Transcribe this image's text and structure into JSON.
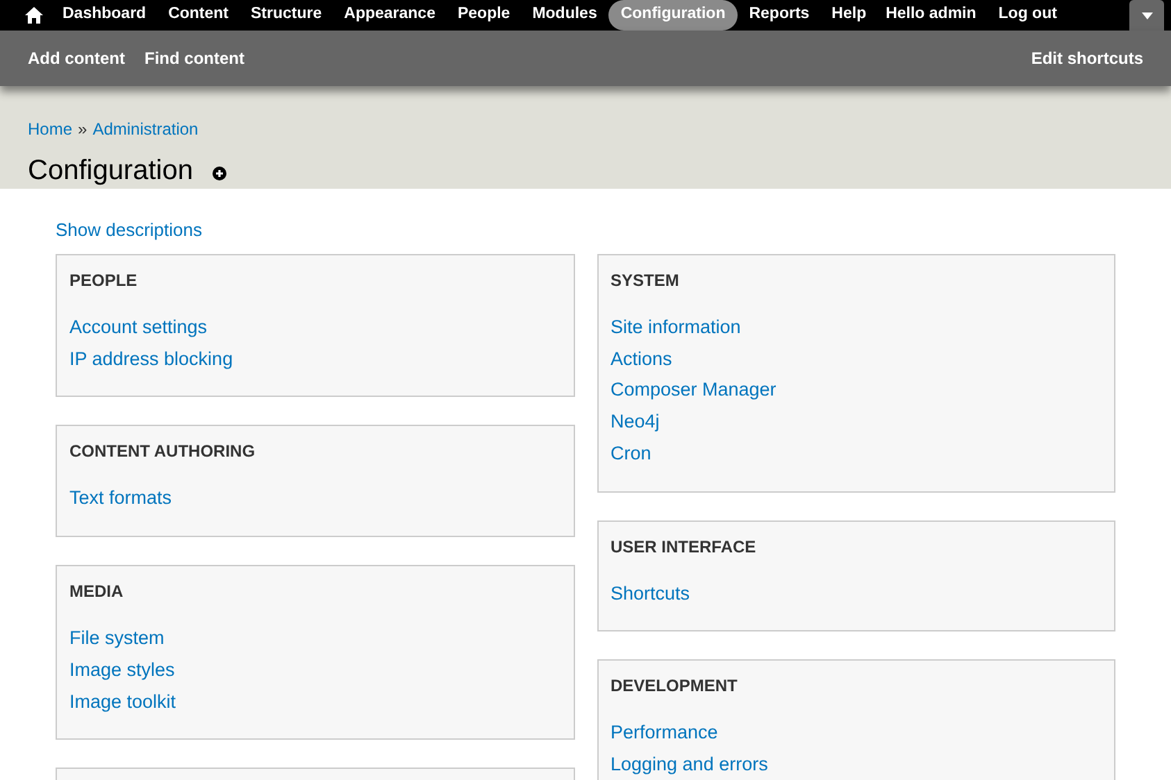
{
  "toolbar": {
    "items": [
      {
        "label": "Dashboard",
        "selected": false
      },
      {
        "label": "Content",
        "selected": false
      },
      {
        "label": "Structure",
        "selected": false
      },
      {
        "label": "Appearance",
        "selected": false
      },
      {
        "label": "People",
        "selected": false
      },
      {
        "label": "Modules",
        "selected": false
      },
      {
        "label": "Configuration",
        "selected": true
      },
      {
        "label": "Reports",
        "selected": false
      },
      {
        "label": "Help",
        "selected": false
      }
    ],
    "greeting": "Hello **admin**",
    "logout": "Log out"
  },
  "shortcuts": {
    "items": [
      "Add content",
      "Find content"
    ],
    "edit": "Edit shortcuts"
  },
  "breadcrumb": [
    "Home",
    "Administration"
  ],
  "breadcrumb_separator": "»",
  "page_title": "Configuration",
  "show_descriptions": "Show descriptions",
  "columns": [
    [
      {
        "kind": "panel",
        "title": "PEOPLE",
        "links": [
          "Account settings",
          "IP address blocking"
        ]
      },
      {
        "kind": "panel",
        "title": "CONTENT AUTHORING",
        "links": [
          "Text formats"
        ]
      },
      {
        "kind": "panel",
        "title": "MEDIA",
        "links": [
          "File system",
          "Image styles",
          "Image toolkit"
        ]
      },
      {
        "kind": "clipped"
      }
    ],
    [
      {
        "kind": "panel",
        "title": "SYSTEM",
        "links": [
          "Site information",
          "Actions",
          "Composer Manager",
          "Neo4j",
          "Cron"
        ]
      },
      {
        "kind": "panel",
        "title": "USER INTERFACE",
        "links": [
          "Shortcuts"
        ]
      },
      {
        "kind": "panel",
        "title": "DEVELOPMENT",
        "links": [
          "Performance",
          "Logging and errors"
        ]
      }
    ]
  ]
}
